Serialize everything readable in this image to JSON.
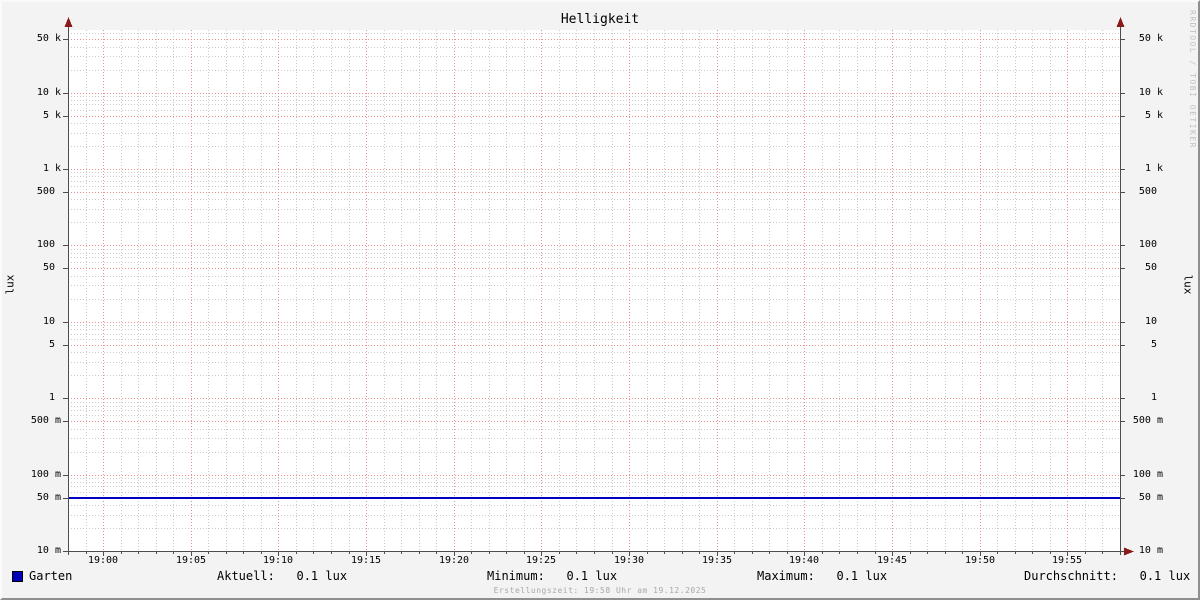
{
  "title": "Helligkeit",
  "watermark": "RRDTOOL / TOBI OETIKER",
  "y_axis_unit": "lux",
  "footer": {
    "creation": "Erstellungszeit: 19:58 Uhr am 19.12.2025"
  },
  "legend": {
    "series_label": "Garten",
    "swatch_color": "#0000b8",
    "stats": [
      {
        "label": "Aktuell:",
        "value": "0.1 lux"
      },
      {
        "label": "Minimum:",
        "value": "0.1 lux"
      },
      {
        "label": "Maximum:",
        "value": "0.1 lux"
      },
      {
        "label": "Durchschnitt:",
        "value": "0.1 lux"
      }
    ]
  },
  "chart_data": {
    "type": "line",
    "title": "Helligkeit",
    "ylabel": "lux",
    "y_scale": "log",
    "y_min": 0.01,
    "y_max": 66000,
    "grid": true,
    "y_ticks": [
      {
        "v": 0.01,
        "label": "10 m"
      },
      {
        "v": 0.05,
        "label": "50 m"
      },
      {
        "v": 0.1,
        "label": "100 m"
      },
      {
        "v": 0.5,
        "label": "500 m"
      },
      {
        "v": 1,
        "label": "1 "
      },
      {
        "v": 5,
        "label": "5 "
      },
      {
        "v": 10,
        "label": "10 "
      },
      {
        "v": 50,
        "label": "50 "
      },
      {
        "v": 100,
        "label": "100 "
      },
      {
        "v": 500,
        "label": "500 "
      },
      {
        "v": 1000,
        "label": "1 k"
      },
      {
        "v": 5000,
        "label": "5 k"
      },
      {
        "v": 10000,
        "label": "10 k"
      },
      {
        "v": 50000,
        "label": "50 k"
      }
    ],
    "x_window": {
      "start": "18:58",
      "end": "19:58",
      "minutes": 60
    },
    "x_ticks": [
      {
        "minute": 2,
        "label": "19:00"
      },
      {
        "minute": 7,
        "label": "19:05"
      },
      {
        "minute": 12,
        "label": "19:10"
      },
      {
        "minute": 17,
        "label": "19:15"
      },
      {
        "minute": 22,
        "label": "19:20"
      },
      {
        "minute": 27,
        "label": "19:25"
      },
      {
        "minute": 32,
        "label": "19:30"
      },
      {
        "minute": 37,
        "label": "19:35"
      },
      {
        "minute": 42,
        "label": "19:40"
      },
      {
        "minute": 47,
        "label": "19:45"
      },
      {
        "minute": 52,
        "label": "19:50"
      },
      {
        "minute": 57,
        "label": "19:55"
      }
    ],
    "series": [
      {
        "name": "Garten",
        "color": "#0000c0",
        "x": [
          "18:58",
          "19:58"
        ],
        "values": [
          0.05,
          0.05
        ]
      }
    ],
    "stats": {
      "aktuell": "0.1 lux",
      "minimum": "0.1 lux",
      "maximum": "0.1 lux",
      "durchschnitt": "0.1 lux"
    },
    "colors": {
      "major_grid": "#ee8f8f",
      "minor_grid": "#cbcbcb",
      "axis": "#4d4d4d",
      "arrow": "#8b1a1a",
      "canvas": "#ffffff",
      "background": "#f3f3f3"
    }
  }
}
